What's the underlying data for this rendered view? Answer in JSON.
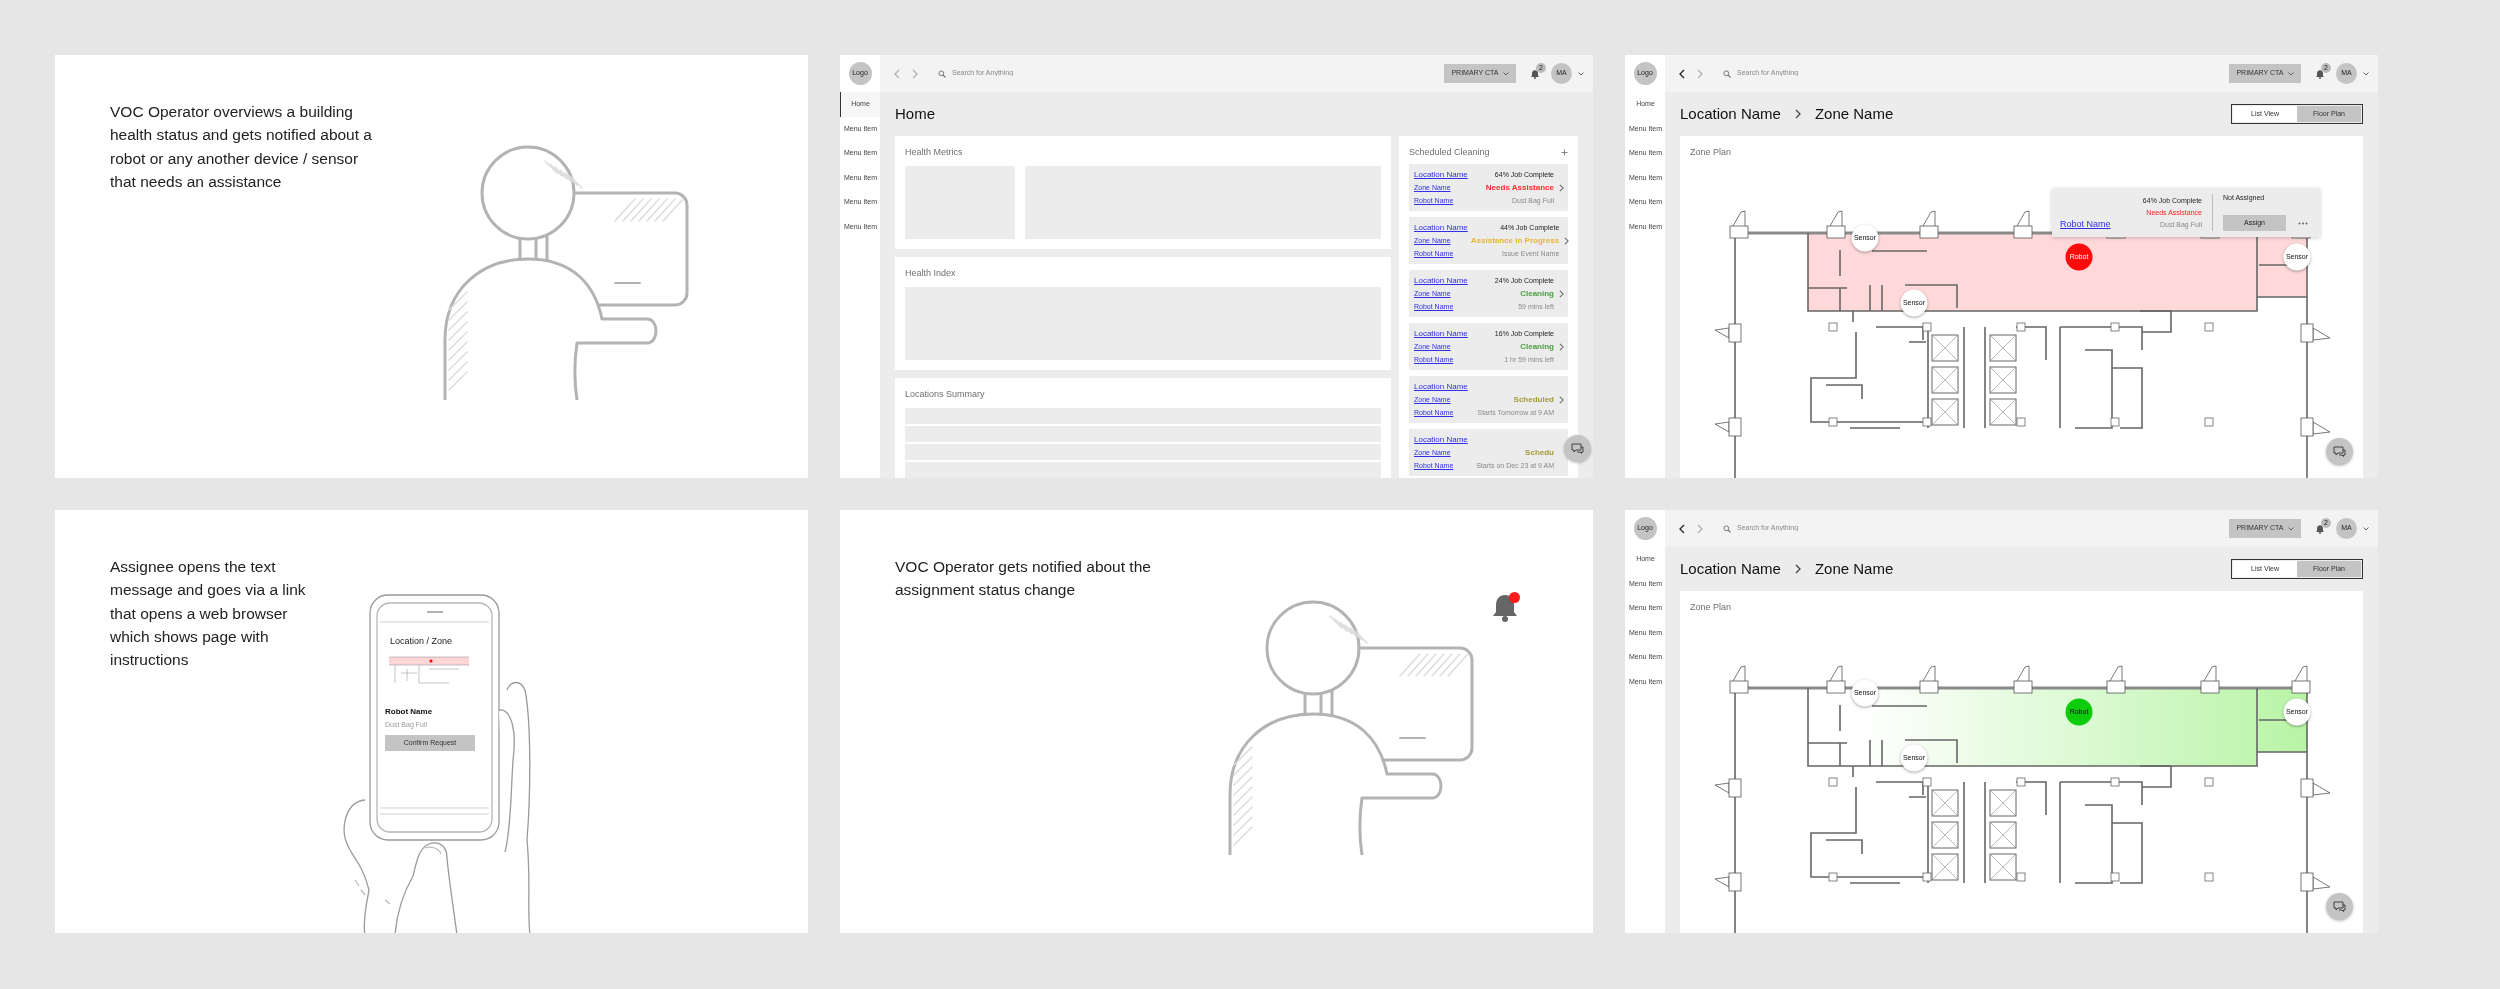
{
  "panels": [
    {
      "kind": "desk_story",
      "caption": "VOC Operator overviews a building health status and gets notified about a robot or any another device / sensor that needs an assistance"
    },
    {
      "kind": "dashboard",
      "app": {
        "logo": "Logo",
        "nav": [
          {
            "label": "Home",
            "selected": true
          },
          {
            "label": "Menu Item",
            "selected": false
          },
          {
            "label": "Menu Item",
            "selected": false
          },
          {
            "label": "Menu Item",
            "selected": false
          },
          {
            "label": "Menu Item",
            "selected": false
          },
          {
            "label": "Menu Item",
            "selected": false
          }
        ],
        "back_enabled": false,
        "forward_enabled": false,
        "search_placeholder": "Search for Anything",
        "cta": "PRIMARY CTA",
        "notifications": "2",
        "avatar": "MA"
      },
      "title": "Home",
      "cards": [
        {
          "title": "Health Metrics",
          "kind": "metrics"
        },
        {
          "title": "Health Index",
          "kind": "chart"
        },
        {
          "title": "Locations Summary",
          "kind": "table"
        }
      ],
      "schedule": {
        "title": "Scheduled Cleaning",
        "items": [
          {
            "location": "Location Name",
            "zone": "Zone Name",
            "robot": "Robot Name",
            "progress": "64% Job Complete",
            "status": "Needs Assistance",
            "color": "#ff2a2a",
            "detail": "Dust Bag Full",
            "chevron": true
          },
          {
            "location": "Location Name",
            "zone": "Zone Name",
            "robot": "Robot Name",
            "progress": "44% Job Complete",
            "status": "Assistance in Progress",
            "color": "#e8b43c",
            "detail": "Issue Event Name",
            "chevron": true
          },
          {
            "location": "Location Name",
            "zone": "Zone Name",
            "robot": "Robot Name",
            "progress": "24% Job Complete",
            "status": "Cleaning",
            "color": "#4b9e43",
            "detail": "59 mins left",
            "chevron": true
          },
          {
            "location": "Location Name",
            "zone": "Zone Name",
            "robot": "Robot Name",
            "progress": "16% Job Complete",
            "status": "Cleaning",
            "color": "#4b9e43",
            "detail": "1 hr 59 mins left",
            "chevron": true
          },
          {
            "location": "Location Name",
            "zone": "Zone Name",
            "robot": "Robot Name",
            "status": "Scheduled",
            "color": "#a59a3a",
            "detail": "Starts Tomorrow at 9 AM",
            "chevron": true
          },
          {
            "location": "Location Name",
            "zone": "Zone Name",
            "robot": "Robot Name",
            "status": "Schedu",
            "color": "#a59a3a",
            "detail": "Starts on Dec 23 at 9 AM",
            "chevron": false
          }
        ]
      }
    },
    {
      "kind": "floorplan",
      "app": {
        "logo": "Logo",
        "nav": [
          {
            "label": "Home",
            "selected": false
          },
          {
            "label": "Menu Item",
            "selected": false
          },
          {
            "label": "Menu Item",
            "selected": false
          },
          {
            "label": "Menu Item",
            "selected": false
          },
          {
            "label": "Menu Item",
            "selected": false
          },
          {
            "label": "Menu Item",
            "selected": false
          }
        ],
        "back_enabled": true,
        "forward_enabled": false,
        "search_placeholder": "Search for Anything",
        "cta": "PRIMARY CTA",
        "notifications": "2",
        "avatar": "MA"
      },
      "breadcrumb": [
        "Location Name",
        "Zone Name"
      ],
      "views": [
        {
          "label": "List View",
          "selected": false
        },
        {
          "label": "Floor Plan",
          "selected": true
        }
      ],
      "card_title": "Zone Plan",
      "sensors": [
        "Sensor",
        "Sensor",
        "Sensor"
      ],
      "robot": {
        "label": "Robot",
        "needs_assistance": true
      },
      "popover": {
        "progress": "64% Job Complete",
        "status": "Needs Assistance",
        "robot": "Robot Name",
        "detail": "Dust Bag Full",
        "assignee": "Not Assigned",
        "button": "Assign"
      }
    },
    {
      "kind": "phone_story",
      "caption": "Assignee opens the text message and goes via a link that opens a web browser which shows page with instructions",
      "phone": {
        "title": "Location / Zone",
        "robot": "Robot Name",
        "detail": "Dust Bag Full",
        "button": "Confirm Request"
      }
    },
    {
      "kind": "desk_story",
      "caption": "VOC Operator gets notified about the assignment status change",
      "bell": {
        "unread": true
      }
    },
    {
      "kind": "floorplan",
      "app": {
        "logo": "Logo",
        "nav": [
          {
            "label": "Home",
            "selected": false
          },
          {
            "label": "Menu Item",
            "selected": false
          },
          {
            "label": "Menu Item",
            "selected": false
          },
          {
            "label": "Menu Item",
            "selected": false
          },
          {
            "label": "Menu Item",
            "selected": false
          },
          {
            "label": "Menu Item",
            "selected": false
          }
        ],
        "back_enabled": true,
        "forward_enabled": false,
        "search_placeholder": "Search for Anything",
        "cta": "PRIMARY CTA",
        "notifications": "2",
        "avatar": "MA"
      },
      "breadcrumb": [
        "Location Name",
        "Zone Name"
      ],
      "views": [
        {
          "label": "List View",
          "selected": false
        },
        {
          "label": "Floor Plan",
          "selected": true
        }
      ],
      "card_title": "Zone Plan",
      "sensors": [
        "Sensor",
        "Sensor",
        "Sensor"
      ],
      "robot": {
        "label": "Robot",
        "needs_assistance": false
      }
    }
  ]
}
